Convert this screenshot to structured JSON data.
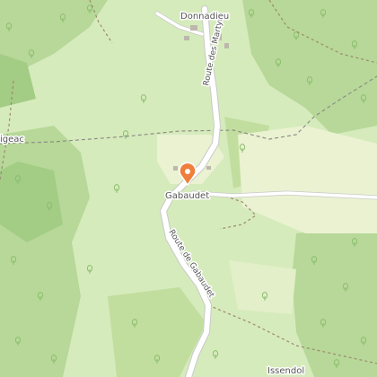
{
  "map": {
    "places": [
      {
        "name": "Donnadieu"
      },
      {
        "name": "Gabaudet"
      },
      {
        "name": "igeac"
      },
      {
        "name": "Issendol"
      }
    ],
    "roads": [
      {
        "name": "Route des Martyrs"
      },
      {
        "name": "Route de Gabaudet"
      }
    ],
    "marker": {
      "label": "Gabaudet",
      "color": "#f07f3c",
      "icon": "map-pin-icon"
    },
    "colors": {
      "forest": "#b7d898",
      "forest_dark": "#a3cc85",
      "meadow": "#d6ebbc",
      "clearing": "#eaf2d2",
      "road": "#ffffff",
      "road_casing": "#c9c9c9",
      "path": "#9b8a70",
      "boundary": "#8e8e86"
    }
  }
}
